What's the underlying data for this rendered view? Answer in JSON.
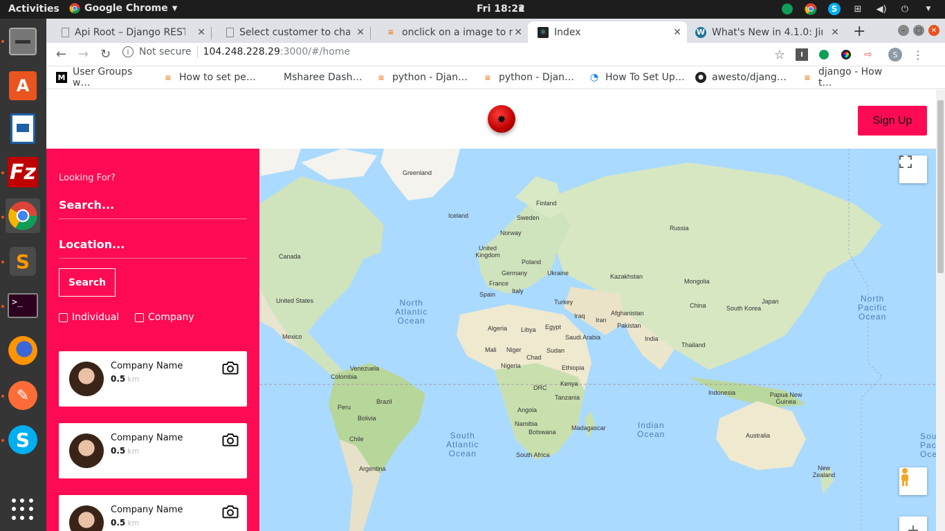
{
  "os": {
    "activities": "Activities",
    "app_name": "Google Chrome",
    "clock": "Fri 18:22"
  },
  "tabs": [
    {
      "title": "Api Root – Django REST f",
      "active": false
    },
    {
      "title": "Select customer to chan",
      "active": false
    },
    {
      "title": "onclick on a image to na",
      "active": false
    },
    {
      "title": "Index",
      "active": true
    },
    {
      "title": "What's New in 4.1.0: Jira",
      "active": false
    }
  ],
  "address": {
    "not_secure": "Not secure",
    "host": "104.248.228.29",
    "path": ":3000/#/home"
  },
  "bookmarks": [
    "User Groups w…",
    "How to set pe…",
    "Msharee Dash…",
    "python - Djan…",
    "python - Djan…",
    "How To Set Up…",
    "awesto/djang…",
    "django - How t…"
  ],
  "header": {
    "signup_label": "Sign Up"
  },
  "sidebar": {
    "looking_for": "Looking For?",
    "search_placeholder": "Search...",
    "location_placeholder": "Location...",
    "search_button": "Search",
    "filters": [
      "Individual",
      "Company"
    ],
    "results": [
      {
        "name": "Company Name",
        "distance": "0.5",
        "unit": "km"
      },
      {
        "name": "Company Name",
        "distance": "0.5",
        "unit": "km"
      },
      {
        "name": "Company Name",
        "distance": "0.5",
        "unit": "km"
      }
    ]
  },
  "map": {
    "labels": [
      "Greenland",
      "Finland",
      "Iceland",
      "Sweden",
      "Norway",
      "Russia",
      "United Kingdom",
      "Poland",
      "Canada",
      "Germany",
      "Ukraine",
      "France",
      "Kazakhstan",
      "Mongolia",
      "Italy",
      "Spain",
      "Turkey",
      "United States",
      "China",
      "South Korea",
      "Japan",
      "Iraq",
      "Iran",
      "Afghanistan",
      "Pakistan",
      "Algeria",
      "Libya",
      "Egypt",
      "Saudi Arabia",
      "India",
      "Mexico",
      "Thailand",
      "Mali",
      "Niger",
      "Chad",
      "Sudan",
      "Nigeria",
      "Ethiopia",
      "Venezuela",
      "Colombia",
      "Kenya",
      "DRC",
      "Tanzania",
      "Indonesia",
      "Papua New Guinea",
      "Peru",
      "Brazil",
      "Bolivia",
      "Angola",
      "Namibia",
      "Botswana",
      "Madagascar",
      "Chile",
      "Australia",
      "South Africa",
      "Argentina",
      "New Zealand"
    ],
    "oceans": [
      "North\nAtlantic\nOcean",
      "North\nPacific\nOcean",
      "South\nAtlantic\nOcean",
      "Indian\nOcean",
      "South\nPacific\nOcean"
    ]
  }
}
